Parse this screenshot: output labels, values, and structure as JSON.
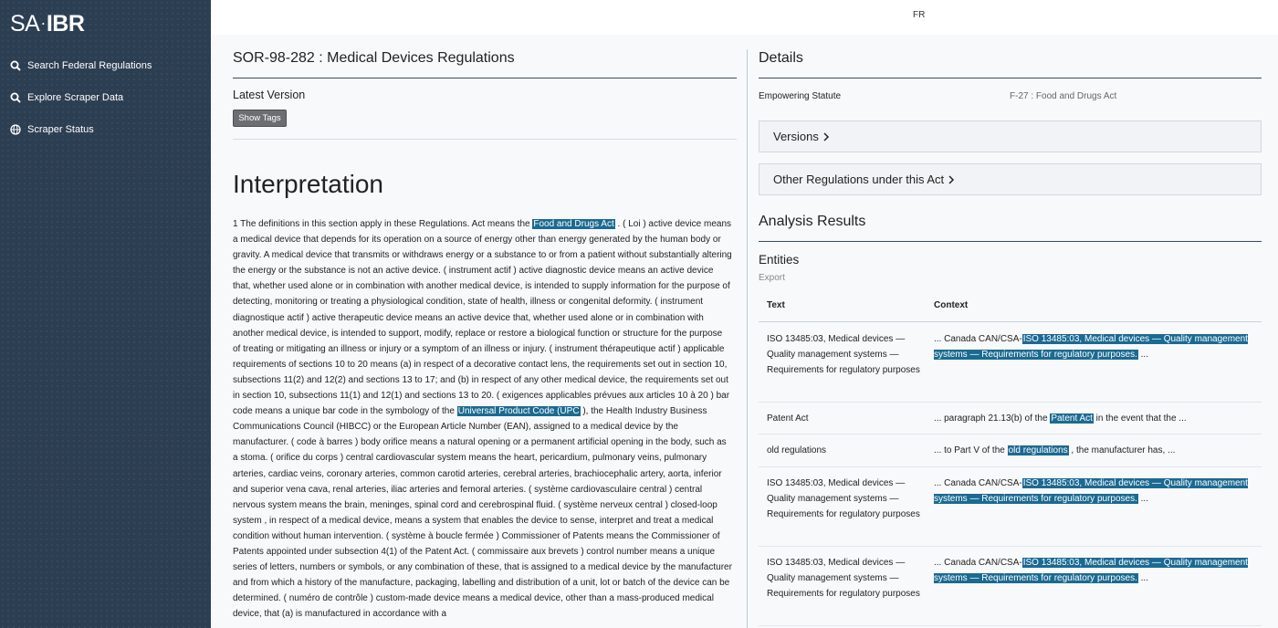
{
  "app": {
    "logo_left": "SA",
    "logo_sep": "·",
    "logo_right": "IBR",
    "lang_toggle": "FR"
  },
  "sidebar": {
    "items": [
      {
        "label": "Search Federal Regulations",
        "icon": "search-icon"
      },
      {
        "label": "Explore Scraper Data",
        "icon": "search-icon"
      },
      {
        "label": "Scraper Status",
        "icon": "globe-icon"
      }
    ]
  },
  "regulation": {
    "title": "SOR-98-282 : Medical Devices Regulations",
    "latest_version": "Latest Version",
    "show_tags": "Show Tags",
    "section_heading": "Interpretation",
    "text_part1": "1 The definitions in this section apply in these Regulations. Act means the ",
    "hl1": "Food and Drugs Act",
    "text_part2": " . ( Loi ) active device means a medical device that depends for its operation on a source of energy other than energy generated by the human body or gravity. A medical device that transmits or withdraws energy or a substance to or from a patient without substantially altering the energy or the substance is not an active device. ( instrument actif ) active diagnostic device means an active device that, whether used alone or in combination with another medical device, is intended to supply information for the purpose of detecting, monitoring or treating a physiological condition, state of health, illness or congenital deformity. ( instrument diagnostique actif ) active therapeutic device means an active device that, whether used alone or in combination with another medical device, is intended to support, modify, replace or restore a biological function or structure for the purpose of treating or mitigating an illness or injury or a symptom of an illness or injury. ( instrument thérapeutique actif ) applicable requirements of sections 10 to 20 means (a) in respect of a decorative contact lens, the requirements set out in section 10, subsections 11(2) and 12(2) and sections 13 to 17; and (b) in respect of any other medical device, the requirements set out in section 10, subsections 11(1) and 12(1) and sections 13 to 20. ( exigences applicables prévues aux articles 10 à 20 ) bar code means a unique bar code in the symbology of the ",
    "hl2": "Universal Product Code (UPC",
    "text_part3": " ), the Health Industry Business Communications Council (HIBCC) or the European Article Number (EAN), assigned to a medical device by the manufacturer. ( code à barres ) body orifice means a natural opening or a permanent artificial opening in the body, such as a stoma. ( orifice du corps ) central cardiovascular system means the heart, pericardium, pulmonary veins, pulmonary arteries, cardiac veins, coronary arteries, common carotid arteries, cerebral arteries, brachiocephalic artery, aorta, inferior and superior vena cava, renal arteries, iliac arteries and femoral arteries. ( système cardiovasculaire central ) central nervous system means the brain, meninges, spinal cord and cerebrospinal fluid. ( système nerveux central ) closed-loop system , in respect of a medical device, means a system that enables the device to sense, interpret and treat a medical condition without human intervention. ( système à boucle fermée ) Commissioner of Patents means the Commissioner of Patents appointed under subsection 4(1) of the Patent Act. ( commissaire aux brevets ) control number means a unique series of letters, numbers or symbols, or any combination of these, that is assigned to a medical device by the manufacturer and from which a history of the manufacture, packaging, labelling and distribution of a unit, lot or batch of the device can be determined. ( numéro de contrôle ) custom-made device means a medical device, other than a mass-produced medical device, that (a) is manufactured in accordance with a"
  },
  "details": {
    "title": "Details",
    "empowering_key": "Empowering Statute",
    "empowering_value": "F-27 : Food and Drugs Act",
    "versions_label": "Versions",
    "other_regs_label": "Other Regulations under this Act"
  },
  "analysis": {
    "title": "Analysis Results",
    "entities_title": "Entities",
    "export_label": "Export",
    "columns": {
      "text": "Text",
      "context": "Context"
    },
    "rows": [
      {
        "text": "ISO 13485:03, Medical devices — Quality management systems — Requirements for regulatory purposes",
        "ctx_pre": "... Canada CAN/CSA-",
        "ctx_hl": "ISO 13485:03, Medical devices — Quality management systems — Requirements for regulatory purposes.",
        "ctx_post": " ..."
      },
      {
        "text": "Patent Act",
        "ctx_pre": "... paragraph 21.13(b) of the ",
        "ctx_hl": "Patent Act",
        "ctx_post": " in the event that the ..."
      },
      {
        "text": "old regulations",
        "ctx_pre": "... to Part V of the ",
        "ctx_hl": "old regulations",
        "ctx_post": " , the manufacturer has, ..."
      },
      {
        "text": "ISO 13485:03, Medical devices — Quality management systems — Requirements for regulatory purposes",
        "ctx_pre": "... Canada CAN/CSA-",
        "ctx_hl": "ISO 13485:03, Medical devices — Quality management systems — Requirements for regulatory purposes.",
        "ctx_post": " ..."
      },
      {
        "text": "ISO 13485:03, Medical devices — Quality management systems — Requirements for regulatory purposes",
        "ctx_pre": "... Canada CAN/CSA-",
        "ctx_hl": "ISO 13485:03, Medical devices — Quality management systems — Requirements for regulatory purposes.",
        "ctx_post": " ..."
      }
    ]
  },
  "colors": {
    "sidebar_bg": "#2c3e52",
    "highlight": "#1b6a91"
  }
}
